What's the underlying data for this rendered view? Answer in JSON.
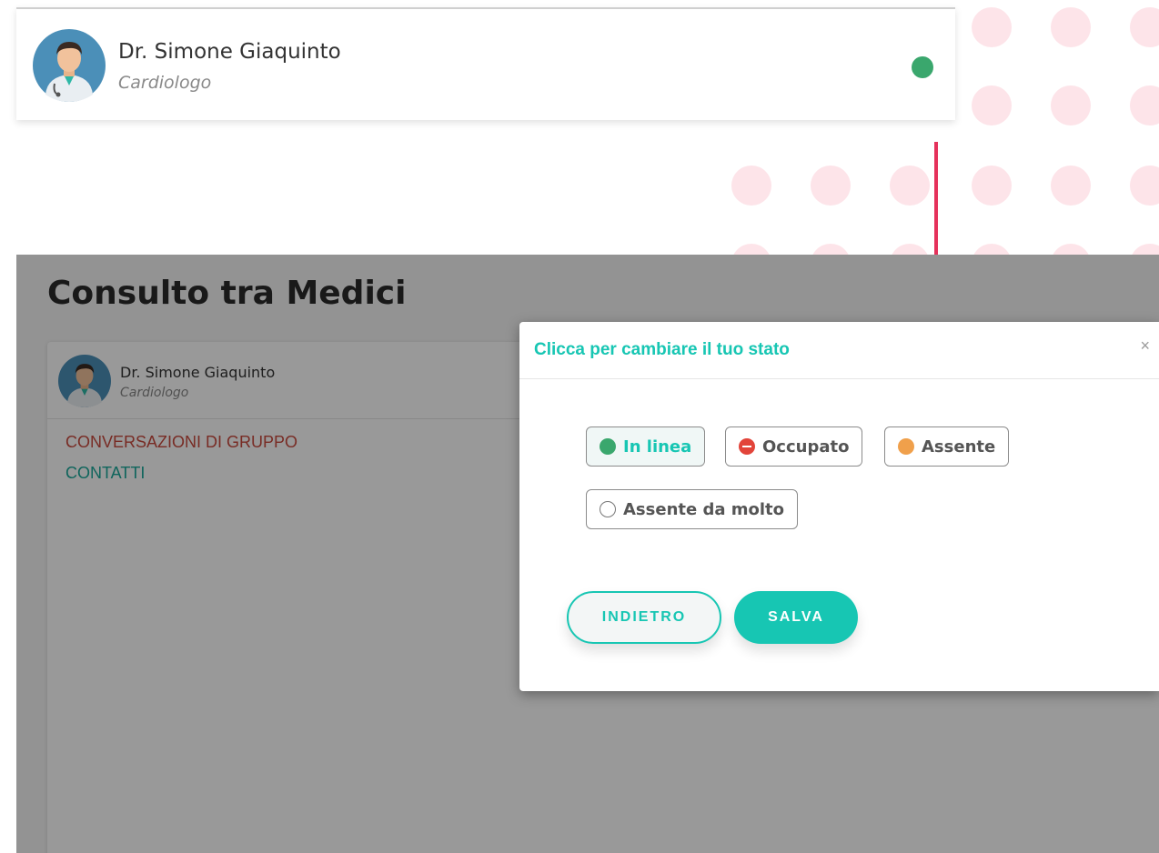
{
  "profile_card": {
    "name": "Dr. Simone Giaquinto",
    "role": "Cardiologo",
    "status": "online",
    "status_color": "#3aa76d"
  },
  "app": {
    "title": "Consulto tra Medici",
    "user": {
      "name": "Dr. Simone Giaquinto",
      "role": "Cardiologo"
    },
    "nav": {
      "group_chats": "CONVERSAZIONI DI GRUPPO",
      "contacts": "CONTATTI"
    }
  },
  "modal": {
    "title": "Clicca per cambiare il tuo stato",
    "close": "×",
    "statuses": [
      {
        "label": "In linea",
        "icon": "online-dot-icon",
        "color": "#3aa76d",
        "selected": true
      },
      {
        "label": "Occupato",
        "icon": "busy-icon",
        "color": "#e2443a",
        "selected": false
      },
      {
        "label": "Assente",
        "icon": "away-dot-icon",
        "color": "#f0a04b",
        "selected": false
      },
      {
        "label": "Assente da molto",
        "icon": "away-long-circle-icon",
        "color": "#777777",
        "selected": false
      }
    ],
    "back_label": "INDIETRO",
    "save_label": "SALVA"
  },
  "colors": {
    "accent": "#17c6b3",
    "arrow": "#e5315b",
    "dots": "#fde4e9"
  }
}
